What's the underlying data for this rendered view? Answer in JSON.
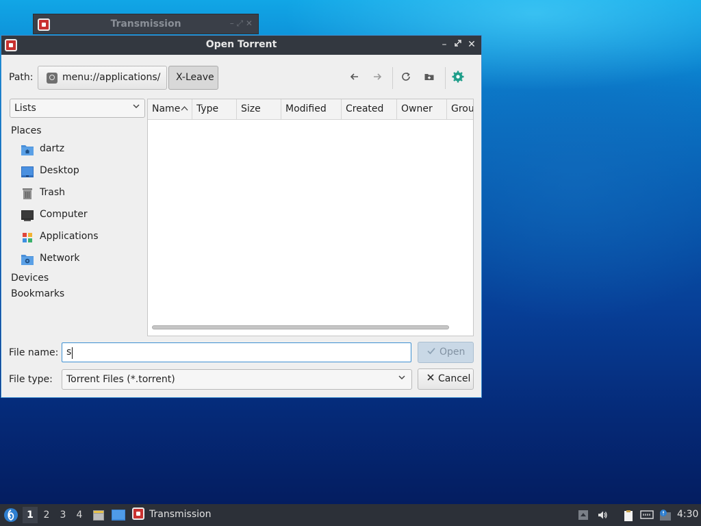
{
  "background_window": {
    "title": "Transmission"
  },
  "dialog": {
    "title": "Open Torrent",
    "path_label": "Path:",
    "path_crumbs": [
      "menu://applications/",
      "X-Leave"
    ],
    "places_combo_value": "Lists",
    "sidebar": {
      "places_header": "Places",
      "places": [
        {
          "label": "dartz",
          "icon": "home-folder-icon"
        },
        {
          "label": "Desktop",
          "icon": "desktop-icon"
        },
        {
          "label": "Trash",
          "icon": "trash-icon"
        },
        {
          "label": "Computer",
          "icon": "computer-icon"
        },
        {
          "label": "Applications",
          "icon": "applications-icon"
        },
        {
          "label": "Network",
          "icon": "network-folder-icon"
        }
      ],
      "devices_header": "Devices",
      "bookmarks_header": "Bookmarks"
    },
    "columns": [
      "Name",
      "Type",
      "Size",
      "Modified",
      "Created",
      "Owner",
      "Grou"
    ],
    "sort_indicator": "^",
    "filename_label": "File name:",
    "filename_value": "s",
    "filetype_label": "File type:",
    "filetype_value": "Torrent Files (*.torrent)",
    "open_label": "Open",
    "cancel_label": "Cancel"
  },
  "taskbar": {
    "workspaces": [
      "1",
      "2",
      "3",
      "4"
    ],
    "active_workspace": "1",
    "task_label": "Transmission",
    "clock": "4:30"
  },
  "colors": {
    "accent": "#3d8fd1",
    "titlebar": "#333840",
    "taskbar": "#2c3038"
  }
}
